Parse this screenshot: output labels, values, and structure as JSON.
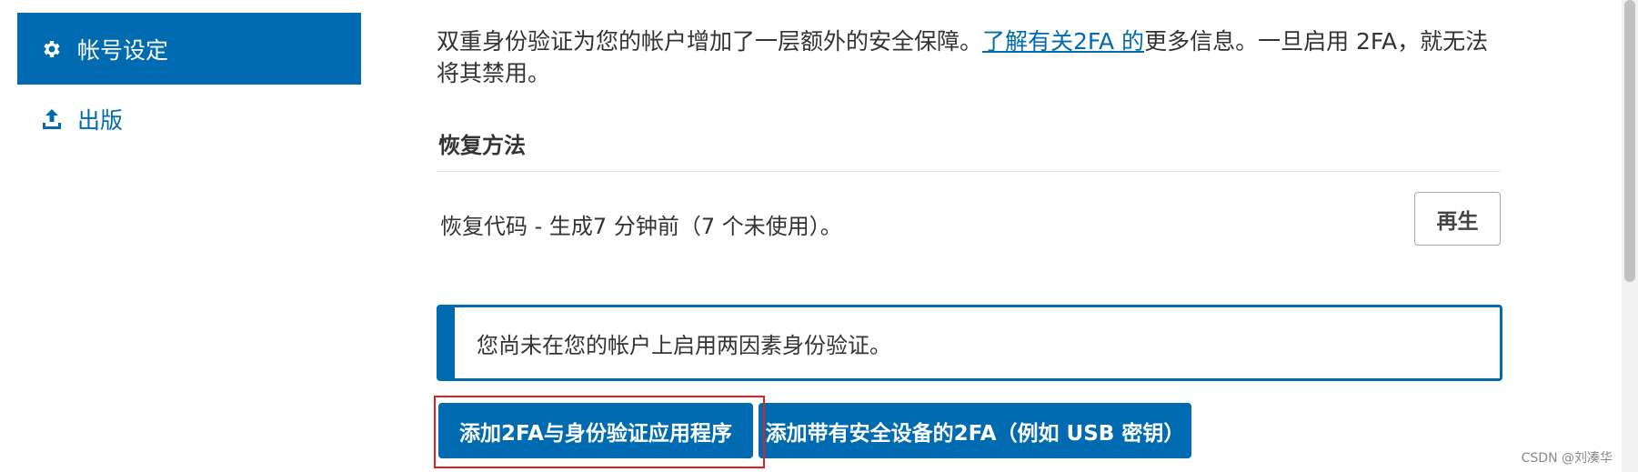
{
  "sidebar": {
    "items": [
      {
        "label": "帐号设定",
        "icon": "gear-icon",
        "active": true
      },
      {
        "label": "出版",
        "icon": "upload-icon",
        "active": false
      }
    ]
  },
  "main": {
    "intro_before_link": "双重身份验证为您的帐户增加了一层额外的安全保障。",
    "intro_link": "了解有关2FA 的",
    "intro_after_link": "更多信息。一旦启用 2FA，就无法将其禁用。",
    "recovery_title": "恢复方法",
    "recovery_text": "恢复代码 - 生成7 分钟前（7 个未使用）。",
    "regenerate_label": "再生",
    "notice_text": "您尚未在您的帐户上启用两因素身份验证。",
    "add_app_button": "添加2FA与身份验证应用程序",
    "add_device_button": "添加带有安全设备的2FA（例如 USB 密钥）"
  },
  "watermark": "CSDN @刘凑华",
  "colors": {
    "accent": "#006bb0",
    "highlight": "#e02020"
  }
}
